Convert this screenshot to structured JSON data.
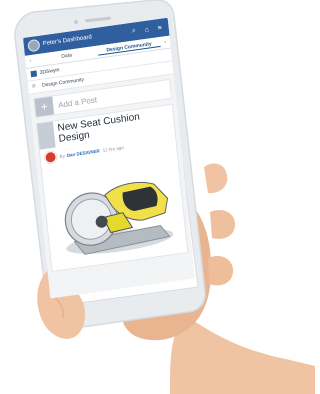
{
  "app": {
    "dashboard_title": "Peter's Dashboard",
    "tabs": [
      {
        "label": "Data"
      },
      {
        "label": "Design Community"
      }
    ],
    "breadcrumb": "3DSwym",
    "community": "Design Community",
    "add_post_placeholder": "Add a Post",
    "post": {
      "title": "New Seat Cushion Design",
      "by": "By",
      "author": "Dan DESIGNER",
      "time": "12 hrs ago"
    }
  },
  "colors": {
    "topbar": "#2f5f9f",
    "accent": "#1f4f8b",
    "saw_yellow": "#e7d92b"
  },
  "icons": [
    "search-icon",
    "tag-icon",
    "menu-icon",
    "chevron-left-icon",
    "chevron-right-icon",
    "plus-icon"
  ]
}
